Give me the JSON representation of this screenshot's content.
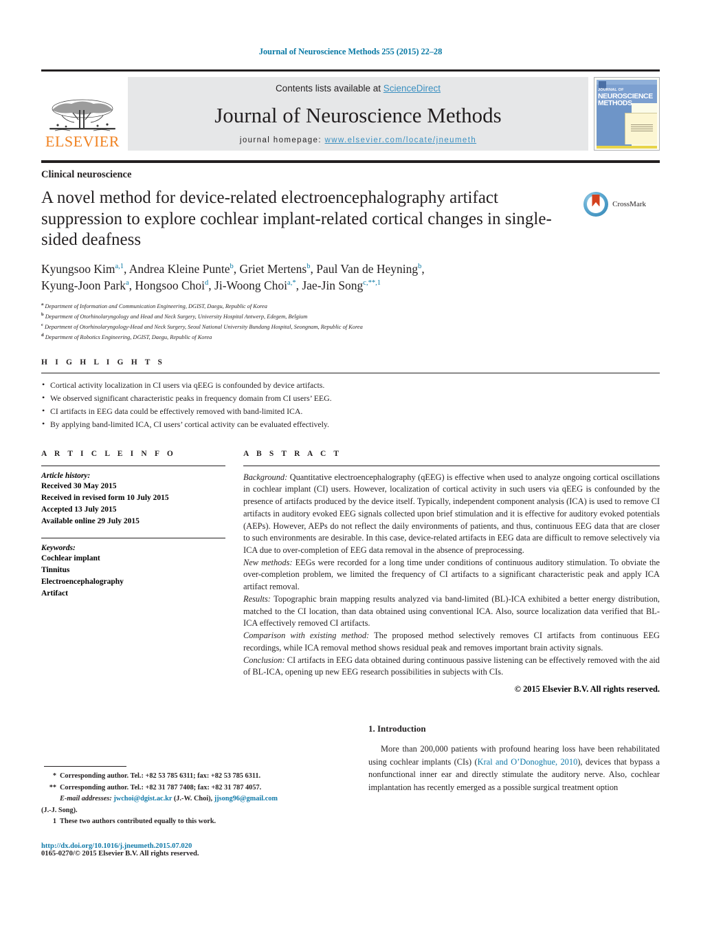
{
  "running_head": "Journal of Neuroscience Methods 255 (2015) 22–28",
  "masthead": {
    "contents_prefix": "Contents lists available at ",
    "sciencedirect": "ScienceDirect",
    "journal_name": "Journal of Neuroscience Methods",
    "homepage_prefix": "journal homepage: ",
    "homepage_url": "www.elsevier.com/locate/jneumeth",
    "publisher": "ELSEVIER",
    "cover": {
      "line1": "JOURNAL OF",
      "line2": "NEUROSCIENCE",
      "line3": "METHODS"
    }
  },
  "article": {
    "section_label": "Clinical neuroscience",
    "title": "A novel method for device-related electroencephalography artifact suppression to explore cochlear implant-related cortical changes in single-sided deafness",
    "crossmark_label": "CrossMark",
    "authors_line1": "Kyungsoo Kim<sup>a,1</sup>, Andrea Kleine Punte<sup>b</sup>, Griet Mertens<sup>b</sup>, Paul Van de Heyning<sup>b</sup>,",
    "authors_line2": "Kyung-Joon Park<sup>a</sup>, Hongsoo Choi<sup>d</sup>, Ji-Woong Choi<sup>a,*</sup>, Jae-Jin Song<sup>c,**,1</sup>",
    "affiliations": [
      {
        "mark": "a",
        "text": "Department of Information and Communication Engineering, DGIST, Daegu, Republic of Korea"
      },
      {
        "mark": "b",
        "text": "Department of Otorhinolaryngology and Head and Neck Surgery, University Hospital Antwerp, Edegem, Belgium"
      },
      {
        "mark": "c",
        "text": "Department of Otorhinolaryngology-Head and Neck Surgery, Seoul National University Bundang Hospital, Seongnam, Republic of Korea"
      },
      {
        "mark": "d",
        "text": "Department of Robotics Engineering, DGIST, Daegu, Republic of Korea"
      }
    ]
  },
  "highlights": {
    "heading": "H I G H L I G H T S",
    "items": [
      "Cortical activity localization in CI users via qEEG is confounded by device artifacts.",
      "We observed significant characteristic peaks in frequency domain from CI users’ EEG.",
      "CI artifacts in EEG data could be effectively removed with band-limited ICA.",
      "By applying band-limited ICA, CI users’ cortical activity can be evaluated effectively."
    ]
  },
  "article_info": {
    "heading": "A R T I C L E   I N F O",
    "history_title": "Article history:",
    "history": [
      "Received 30 May 2015",
      "Received in revised form 10 July 2015",
      "Accepted 13 July 2015",
      "Available online 29 July 2015"
    ],
    "keywords_title": "Keywords:",
    "keywords": [
      "Cochlear implant",
      "Tinnitus",
      "Electroencephalography",
      "Artifact"
    ]
  },
  "abstract": {
    "heading": "A B S T R A C T",
    "background_label": "Background:",
    "background": " Quantitative electroencephalography (qEEG) is effective when used to analyze ongoing cortical oscillations in cochlear implant (CI) users. However, localization of cortical activity in such users via qEEG is confounded by the presence of artifacts produced by the device itself. Typically, independent component analysis (ICA) is used to remove CI artifacts in auditory evoked EEG signals collected upon brief stimulation and it is effective for auditory evoked potentials (AEPs). However, AEPs do not reflect the daily environments of patients, and thus, continuous EEG data that are closer to such environments are desirable. In this case, device-related artifacts in EEG data are difficult to remove selectively via ICA due to over-completion of EEG data removal in the absence of preprocessing.",
    "newmethods_label": "New methods:",
    "newmethods": " EEGs were recorded for a long time under conditions of continuous auditory stimulation. To obviate the over-completion problem, we limited the frequency of CI artifacts to a significant characteristic peak and apply ICA artifact removal.",
    "results_label": "Results:",
    "results": " Topographic brain mapping results analyzed via band-limited (BL)-ICA exhibited a better energy distribution, matched to the CI location, than data obtained using conventional ICA. Also, source localization data verified that BL-ICA effectively removed CI artifacts.",
    "comparison_label": "Comparison with existing method:",
    "comparison": " The proposed method selectively removes CI artifacts from continuous EEG recordings, while ICA removal method shows residual peak and removes important brain activity signals.",
    "conclusion_label": "Conclusion:",
    "conclusion": " CI artifacts in EEG data obtained during continuous passive listening can be effectively removed with the aid of BL-ICA, opening up new EEG research possibilities in subjects with CIs.",
    "copyright": "© 2015 Elsevier B.V. All rights reserved."
  },
  "footnotes": {
    "corresponding1_mark": "*",
    "corresponding1": "Corresponding author. Tel.: +82 53 785 6311; fax: +82 53 785 6311.",
    "corresponding2_mark": "**",
    "corresponding2": "Corresponding author. Tel.: +82 31 787 7408; fax: +82 31 787 4057.",
    "email_label": "E-mail addresses:",
    "email1": "jwchoi@dgist.ac.kr",
    "email1_attr": "(J.-W. Choi),",
    "email2": "jjsong96@gmail.com",
    "email2_attr": "(J.-J. Song).",
    "equal_mark": "1",
    "equal_contrib": "These two authors contributed equally to this work."
  },
  "doi_block": {
    "doi": "http://dx.doi.org/10.1016/j.jneumeth.2015.07.020",
    "issn": "0165-0270/© 2015 Elsevier B.V. All rights reserved."
  },
  "introduction": {
    "heading": "1.  Introduction",
    "text_before_link": "More than 200,000 patients with profound hearing loss have been rehabilitated using cochlear implants (CIs) (",
    "citation_link": "Kral and O’Donoghue, 2010",
    "text_after_link": "), devices that bypass a nonfunctional inner ear and directly stimulate the auditory nerve. Also, cochlear implantation has recently emerged as a possible surgical treatment option"
  },
  "colors": {
    "link_teal": "#0b7aa5",
    "sciencedirect_blue": "#3a8fc0",
    "elsevier_orange": "#f08221",
    "masthead_gray": "#e6e7e8",
    "crossmark_red": "#d3411e"
  }
}
